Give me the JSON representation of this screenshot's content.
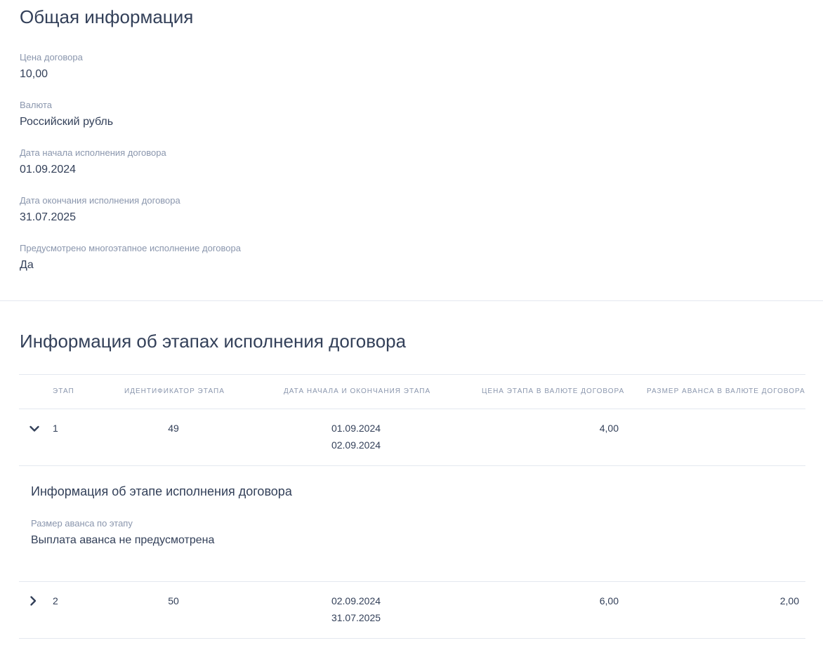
{
  "general": {
    "title": "Общая информация",
    "fields": [
      {
        "label": "Цена договора",
        "value": "10,00"
      },
      {
        "label": "Валюта",
        "value": "Российский рубль"
      },
      {
        "label": "Дата начала исполнения договора",
        "value": "01.09.2024"
      },
      {
        "label": "Дата окончания исполнения договора",
        "value": "31.07.2025"
      },
      {
        "label": "Предусмотрено многоэтапное исполнение договора",
        "value": "Да"
      }
    ]
  },
  "stages": {
    "title": "Информация об этапах исполнения договора",
    "columns": [
      "Этап",
      "Идентификатор этапа",
      "Дата начала и окончания этапа",
      "Цена этапа в валюте договора",
      "Размер аванса в валюте договора"
    ],
    "rows": [
      {
        "stage": "1",
        "id": "49",
        "start": "01.09.2024",
        "end": "02.09.2024",
        "price": "4,00",
        "advance": "",
        "expanded": true,
        "details": {
          "title": "Информация об этапе исполнения договора",
          "label": "Размер аванса по этапу",
          "value": "Выплата аванса не предусмотрена"
        }
      },
      {
        "stage": "2",
        "id": "50",
        "start": "02.09.2024",
        "end": "31.07.2025",
        "price": "6,00",
        "advance": "2,00",
        "expanded": false
      }
    ]
  },
  "icons": {
    "expanded": "chevron-down-icon",
    "collapsed": "chevron-right-icon"
  },
  "colors": {
    "text": "#334059",
    "muted": "#8a96ad",
    "divider": "#e4e8ef"
  }
}
